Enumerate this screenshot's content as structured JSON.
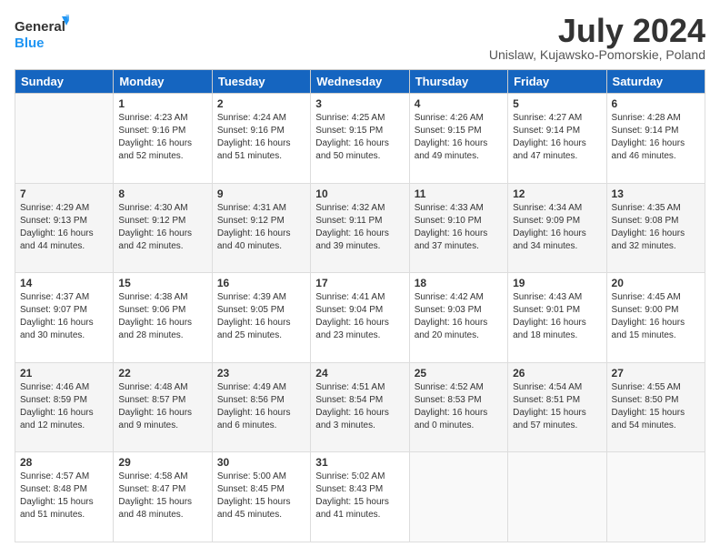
{
  "logo": {
    "line1": "General",
    "line2": "Blue"
  },
  "title": "July 2024",
  "location": "Unislaw, Kujawsko-Pomorskie, Poland",
  "headers": [
    "Sunday",
    "Monday",
    "Tuesday",
    "Wednesday",
    "Thursday",
    "Friday",
    "Saturday"
  ],
  "weeks": [
    [
      {
        "day": "",
        "info": ""
      },
      {
        "day": "1",
        "info": "Sunrise: 4:23 AM\nSunset: 9:16 PM\nDaylight: 16 hours\nand 52 minutes."
      },
      {
        "day": "2",
        "info": "Sunrise: 4:24 AM\nSunset: 9:16 PM\nDaylight: 16 hours\nand 51 minutes."
      },
      {
        "day": "3",
        "info": "Sunrise: 4:25 AM\nSunset: 9:15 PM\nDaylight: 16 hours\nand 50 minutes."
      },
      {
        "day": "4",
        "info": "Sunrise: 4:26 AM\nSunset: 9:15 PM\nDaylight: 16 hours\nand 49 minutes."
      },
      {
        "day": "5",
        "info": "Sunrise: 4:27 AM\nSunset: 9:14 PM\nDaylight: 16 hours\nand 47 minutes."
      },
      {
        "day": "6",
        "info": "Sunrise: 4:28 AM\nSunset: 9:14 PM\nDaylight: 16 hours\nand 46 minutes."
      }
    ],
    [
      {
        "day": "7",
        "info": "Sunrise: 4:29 AM\nSunset: 9:13 PM\nDaylight: 16 hours\nand 44 minutes."
      },
      {
        "day": "8",
        "info": "Sunrise: 4:30 AM\nSunset: 9:12 PM\nDaylight: 16 hours\nand 42 minutes."
      },
      {
        "day": "9",
        "info": "Sunrise: 4:31 AM\nSunset: 9:12 PM\nDaylight: 16 hours\nand 40 minutes."
      },
      {
        "day": "10",
        "info": "Sunrise: 4:32 AM\nSunset: 9:11 PM\nDaylight: 16 hours\nand 39 minutes."
      },
      {
        "day": "11",
        "info": "Sunrise: 4:33 AM\nSunset: 9:10 PM\nDaylight: 16 hours\nand 37 minutes."
      },
      {
        "day": "12",
        "info": "Sunrise: 4:34 AM\nSunset: 9:09 PM\nDaylight: 16 hours\nand 34 minutes."
      },
      {
        "day": "13",
        "info": "Sunrise: 4:35 AM\nSunset: 9:08 PM\nDaylight: 16 hours\nand 32 minutes."
      }
    ],
    [
      {
        "day": "14",
        "info": "Sunrise: 4:37 AM\nSunset: 9:07 PM\nDaylight: 16 hours\nand 30 minutes."
      },
      {
        "day": "15",
        "info": "Sunrise: 4:38 AM\nSunset: 9:06 PM\nDaylight: 16 hours\nand 28 minutes."
      },
      {
        "day": "16",
        "info": "Sunrise: 4:39 AM\nSunset: 9:05 PM\nDaylight: 16 hours\nand 25 minutes."
      },
      {
        "day": "17",
        "info": "Sunrise: 4:41 AM\nSunset: 9:04 PM\nDaylight: 16 hours\nand 23 minutes."
      },
      {
        "day": "18",
        "info": "Sunrise: 4:42 AM\nSunset: 9:03 PM\nDaylight: 16 hours\nand 20 minutes."
      },
      {
        "day": "19",
        "info": "Sunrise: 4:43 AM\nSunset: 9:01 PM\nDaylight: 16 hours\nand 18 minutes."
      },
      {
        "day": "20",
        "info": "Sunrise: 4:45 AM\nSunset: 9:00 PM\nDaylight: 16 hours\nand 15 minutes."
      }
    ],
    [
      {
        "day": "21",
        "info": "Sunrise: 4:46 AM\nSunset: 8:59 PM\nDaylight: 16 hours\nand 12 minutes."
      },
      {
        "day": "22",
        "info": "Sunrise: 4:48 AM\nSunset: 8:57 PM\nDaylight: 16 hours\nand 9 minutes."
      },
      {
        "day": "23",
        "info": "Sunrise: 4:49 AM\nSunset: 8:56 PM\nDaylight: 16 hours\nand 6 minutes."
      },
      {
        "day": "24",
        "info": "Sunrise: 4:51 AM\nSunset: 8:54 PM\nDaylight: 16 hours\nand 3 minutes."
      },
      {
        "day": "25",
        "info": "Sunrise: 4:52 AM\nSunset: 8:53 PM\nDaylight: 16 hours\nand 0 minutes."
      },
      {
        "day": "26",
        "info": "Sunrise: 4:54 AM\nSunset: 8:51 PM\nDaylight: 15 hours\nand 57 minutes."
      },
      {
        "day": "27",
        "info": "Sunrise: 4:55 AM\nSunset: 8:50 PM\nDaylight: 15 hours\nand 54 minutes."
      }
    ],
    [
      {
        "day": "28",
        "info": "Sunrise: 4:57 AM\nSunset: 8:48 PM\nDaylight: 15 hours\nand 51 minutes."
      },
      {
        "day": "29",
        "info": "Sunrise: 4:58 AM\nSunset: 8:47 PM\nDaylight: 15 hours\nand 48 minutes."
      },
      {
        "day": "30",
        "info": "Sunrise: 5:00 AM\nSunset: 8:45 PM\nDaylight: 15 hours\nand 45 minutes."
      },
      {
        "day": "31",
        "info": "Sunrise: 5:02 AM\nSunset: 8:43 PM\nDaylight: 15 hours\nand 41 minutes."
      },
      {
        "day": "",
        "info": ""
      },
      {
        "day": "",
        "info": ""
      },
      {
        "day": "",
        "info": ""
      }
    ]
  ]
}
